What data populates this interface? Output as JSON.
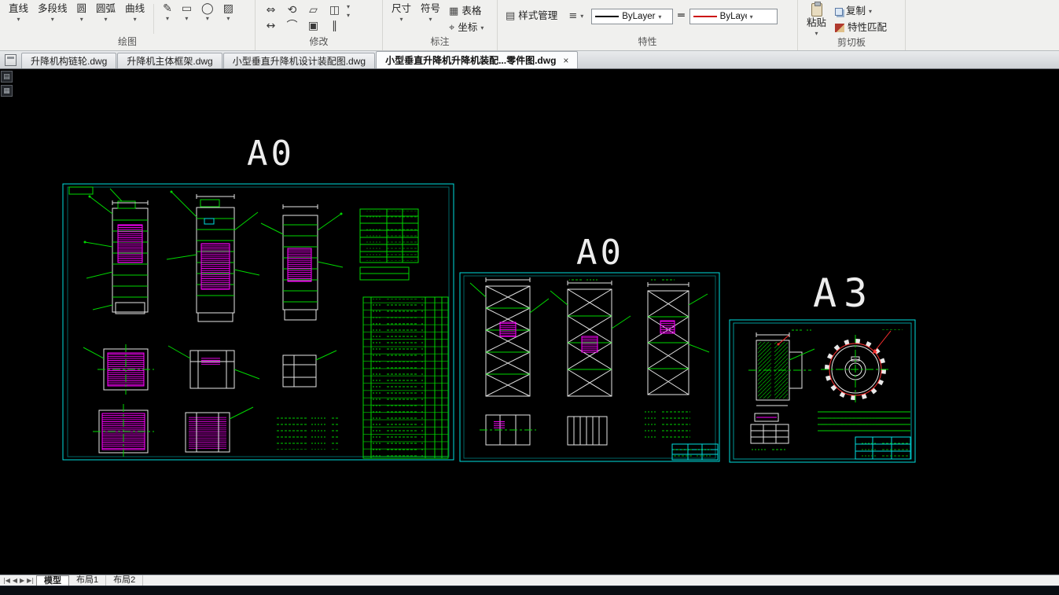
{
  "icons": {
    "dropdown": "▾",
    "close": "×",
    "style_manager": "▤",
    "list": "≡",
    "lineweight": "═",
    "table": "▦",
    "coord": "⌖",
    "nav_first": "|◀",
    "nav_prev": "◀",
    "nav_next": "▶",
    "nav_last": "▶|"
  },
  "ribbon": {
    "draw": {
      "label": "绘图",
      "tools": [
        {
          "label": "直线"
        },
        {
          "label": "多段线"
        },
        {
          "label": "圆"
        },
        {
          "label": "圆弧"
        },
        {
          "label": "曲线"
        }
      ],
      "extra": [
        {
          "glyph": "✎"
        },
        {
          "glyph": "▭"
        },
        {
          "glyph": "◯"
        },
        {
          "glyph": "▨"
        }
      ]
    },
    "modify": {
      "label": "修改",
      "icons": [
        {
          "glyph": "⇔"
        },
        {
          "glyph": "⟲"
        },
        {
          "glyph": "▱"
        },
        {
          "glyph": "◫"
        },
        {
          "glyph": "↔"
        },
        {
          "glyph": "⌒"
        },
        {
          "glyph": "▣"
        },
        {
          "glyph": "∥"
        }
      ]
    },
    "annotate": {
      "label": "标注",
      "dim": "尺寸",
      "symbol": "符号",
      "table": "表格",
      "coord": "坐标"
    },
    "properties": {
      "label": "特性",
      "style_manager": "样式管理",
      "linetype_value": "ByLayer",
      "color_value": "ByLayer"
    },
    "clipboard": {
      "label": "剪切板",
      "paste": "粘贴",
      "copy": "复制",
      "match": "特性匹配"
    }
  },
  "doc_tabs": [
    {
      "label": "升降机构链轮.dwg",
      "active": false
    },
    {
      "label": "升降机主体框架.dwg",
      "active": false
    },
    {
      "label": "小型垂直升降机设计装配图.dwg",
      "active": false
    },
    {
      "label": "小型垂直升降机升降机装配...零件图.dwg",
      "active": true
    }
  ],
  "canvas": {
    "sheet_labels": [
      "A0",
      "A0",
      "A3"
    ]
  },
  "layout_tabs": [
    "模型",
    "布局1",
    "布局2"
  ]
}
